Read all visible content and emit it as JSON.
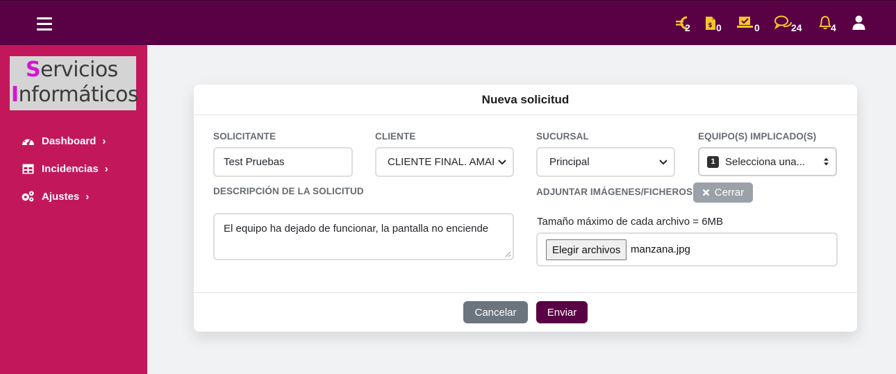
{
  "topbar": {
    "icons": [
      {
        "name": "euro-icon",
        "count": "2"
      },
      {
        "name": "invoice-icon",
        "count": "0"
      },
      {
        "name": "approved-icon",
        "count": "0"
      },
      {
        "name": "chat-icon",
        "count": "24"
      },
      {
        "name": "bell-icon",
        "count": "4"
      },
      {
        "name": "user-icon",
        "count": ""
      }
    ]
  },
  "sidebar": {
    "logo": {
      "line1_cap": "S",
      "line1_rest": "ervicios",
      "line2_cap": "I",
      "line2_rest": "nformáticos"
    },
    "items": [
      {
        "label": "Dashboard",
        "icon": "gauge-icon"
      },
      {
        "label": "Incidencias",
        "icon": "table-icon"
      },
      {
        "label": "Ajustes",
        "icon": "gears-icon"
      }
    ]
  },
  "form": {
    "title": "Nueva solicitud",
    "solicitante": {
      "label": "SOLICITANTE",
      "value": "Test Pruebas"
    },
    "cliente": {
      "label": "CLIENTE",
      "value": "CLIENTE FINAL. AMAI"
    },
    "sucursal": {
      "label": "SUCURSAL",
      "value": "Principal"
    },
    "equipos": {
      "label": "EQUIPO(S) IMPLICADO(S)",
      "badge": "1",
      "value": "Selecciona una..."
    },
    "descripcion": {
      "label": "DESCRIPCIÓN DE LA SOLICITUD",
      "value": "El equipo ha dejado de funcionar, la pantalla no enciende"
    },
    "adjuntar": {
      "label": "ADJUNTAR IMÁGENES/FICHEROS",
      "close_label": "Cerrar",
      "max_size": "Tamaño máximo de cada archivo = 6MB",
      "choose_label": "Elegir archivos",
      "file_name": "manzana.jpg"
    },
    "cancel_label": "Cancelar",
    "submit_label": "Enviar"
  },
  "colors": {
    "topbar": "#5a0145",
    "sidebar": "#c2185b",
    "icon_yellow": "#f7c52b",
    "logo_accent": "#d416d0"
  }
}
